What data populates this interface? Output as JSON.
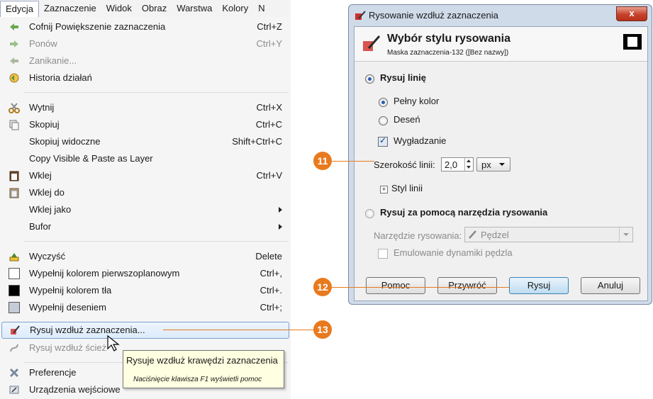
{
  "menubar": {
    "items": [
      "Edycja",
      "Zaznaczenie",
      "Widok",
      "Obraz",
      "Warstwa",
      "Kolory",
      "N"
    ]
  },
  "menu": {
    "items": [
      {
        "label": "Cofnij Powiększenie zaznaczenia",
        "shortcut": "Ctrl+Z",
        "icon": "undo-arrow-icon"
      },
      {
        "label": "Ponów",
        "shortcut": "Ctrl+Y",
        "icon": "redo-arrow-icon",
        "disabled": true
      },
      {
        "label": "Zanikanie...",
        "shortcut": "",
        "icon": "fade-icon",
        "disabled": true
      },
      {
        "label": "Historia działań",
        "shortcut": "",
        "icon": "history-icon"
      },
      {
        "label": "Wytnij",
        "shortcut": "Ctrl+X",
        "icon": "scissors-icon"
      },
      {
        "label": "Skopiuj",
        "shortcut": "Ctrl+C",
        "icon": "copy-icon"
      },
      {
        "label": "Skopiuj widoczne",
        "shortcut": "Shift+Ctrl+C",
        "icon": ""
      },
      {
        "label": "Copy Visible & Paste as Layer",
        "shortcut": "",
        "icon": ""
      },
      {
        "label": "Wklej",
        "shortcut": "Ctrl+V",
        "icon": "paste-icon"
      },
      {
        "label": "Wklej do",
        "shortcut": "",
        "icon": "paste-into-icon"
      },
      {
        "label": "Wklej jako",
        "shortcut": "",
        "icon": "",
        "submenu": true
      },
      {
        "label": "Bufor",
        "shortcut": "",
        "icon": "",
        "submenu": true
      },
      {
        "label": "Wyczyść",
        "shortcut": "Delete",
        "icon": "eraser-icon"
      },
      {
        "label": "Wypełnij kolorem pierwszoplanowym",
        "shortcut": "Ctrl+,",
        "icon": "fill-fg-icon"
      },
      {
        "label": "Wypełnij kolorem tła",
        "shortcut": "Ctrl+.",
        "icon": "fill-bg-icon"
      },
      {
        "label": "Wypełnij deseniem",
        "shortcut": "Ctrl+;",
        "icon": "fill-pattern-icon"
      },
      {
        "label": "Rysuj wzdłuż zaznaczenia...",
        "shortcut": "",
        "icon": "stroke-selection-icon",
        "highlighted": true
      },
      {
        "label": "Rysuj wzdłuż ścież",
        "shortcut": "",
        "icon": "stroke-path-icon",
        "disabled": true
      },
      {
        "label": "Preferencje",
        "shortcut": "",
        "icon": "preferences-icon"
      },
      {
        "label": "Urządzenia wejściowe",
        "shortcut": "",
        "icon": "input-devices-icon"
      }
    ]
  },
  "tooltip": {
    "title": "Rysuje wzdłuż krawędzi zaznaczenia",
    "hint": "Naciśnięcie klawisza F1 wyświetli pomoc"
  },
  "dialog": {
    "title": "Rysowanie wzdłuż zaznaczenia",
    "close": "x",
    "header_title": "Wybór stylu rysowania",
    "header_sub": "Maska zaznaczenia-132 ([Bez nazwy])",
    "stroke_line": "Rysuj linię",
    "solid_color": "Pełny kolor",
    "pattern": "Deseń",
    "antialias": "Wygładzanie",
    "line_width_label": "Szerokość linii:",
    "line_width_value": "2,0",
    "unit": "px",
    "line_style": "Styl linii",
    "stroke_tool": "Rysuj za pomocą narzędzia rysowania",
    "paint_tool_label": "Narzędzie rysowania:",
    "paint_tool_value": "Pędzel",
    "emulate_dynamics": "Emulowanie dynamiki pędzla",
    "buttons": {
      "help": "Pomoc",
      "reset": "Przywróć",
      "stroke": "Rysuj",
      "cancel": "Anuluj"
    }
  },
  "callouts": [
    "11",
    "12",
    "13"
  ],
  "colors": {
    "callout": "#e87a1e",
    "highlight_border": "#7da2ce"
  }
}
